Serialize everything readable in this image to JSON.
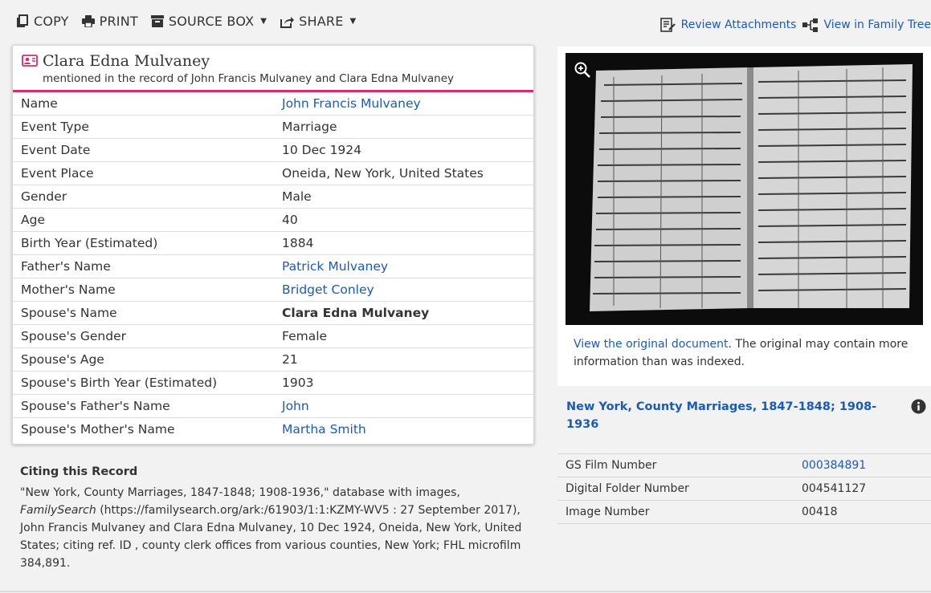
{
  "toolbar": {
    "copy": "COPY",
    "print": "PRINT",
    "source_box": "SOURCE BOX",
    "share": "SHARE",
    "review_attachments": "Review Attachments",
    "view_in_tree": "View in Family Tree"
  },
  "record": {
    "title": "Clara Edna Mulvaney",
    "subtitle": "mentioned in the record of John Francis Mulvaney and Clara Edna Mulvaney",
    "accent_color": "#d0306f",
    "facts": [
      {
        "label": "Name",
        "value": "John Francis Mulvaney"
      },
      {
        "label": "Event Type",
        "value": "Marriage"
      },
      {
        "label": "Event Date",
        "value": "10 Dec 1924"
      },
      {
        "label": "Event Place",
        "value": "Oneida, New York, United States"
      },
      {
        "label": "Gender",
        "value": "Male"
      },
      {
        "label": "Age",
        "value": "40"
      },
      {
        "label": "Birth Year (Estimated)",
        "value": "1884"
      },
      {
        "label": "Father's Name",
        "value": "Patrick Mulvaney"
      },
      {
        "label": "Mother's Name",
        "value": "Bridget Conley"
      },
      {
        "label": "Spouse's Name",
        "value": "Clara Edna Mulvaney"
      },
      {
        "label": "Spouse's Gender",
        "value": "Female"
      },
      {
        "label": "Spouse's Age",
        "value": "21"
      },
      {
        "label": "Spouse's Birth Year (Estimated)",
        "value": "1903"
      },
      {
        "label": "Spouse's Father's Name",
        "value": "John"
      },
      {
        "label": "Spouse's Mother's Name",
        "value": "Martha Smith"
      }
    ]
  },
  "image_panel": {
    "view_link": "View the original document",
    "note": ". The original may contain more information than was indexed."
  },
  "collection": {
    "title": "New York, County Marriages, 1847-1848; 1908-1936",
    "rows": [
      {
        "label": "GS Film Number",
        "value": "000384891"
      },
      {
        "label": "Digital Folder Number",
        "value": "004541127"
      },
      {
        "label": "Image Number",
        "value": "00418"
      }
    ]
  },
  "citing": {
    "heading": "Citing this Record",
    "part1": "\"New York, County Marriages, 1847-1848; 1908-1936,\" database with images, ",
    "site": "FamilySearch",
    "part2": " (https://familysearch.org/ark:/61903/1:1:KZMY-WV5 : 27 September 2017), John Francis Mulvaney and Clara Edna Mulvaney, 10 Dec 1924, Oneida, New York, United States; citing ref. ID , county clerk offices from various counties, New York; FHL microfilm 384,891."
  },
  "colors": {
    "link": "#1a5bb5",
    "background": "#f2f2f2"
  }
}
